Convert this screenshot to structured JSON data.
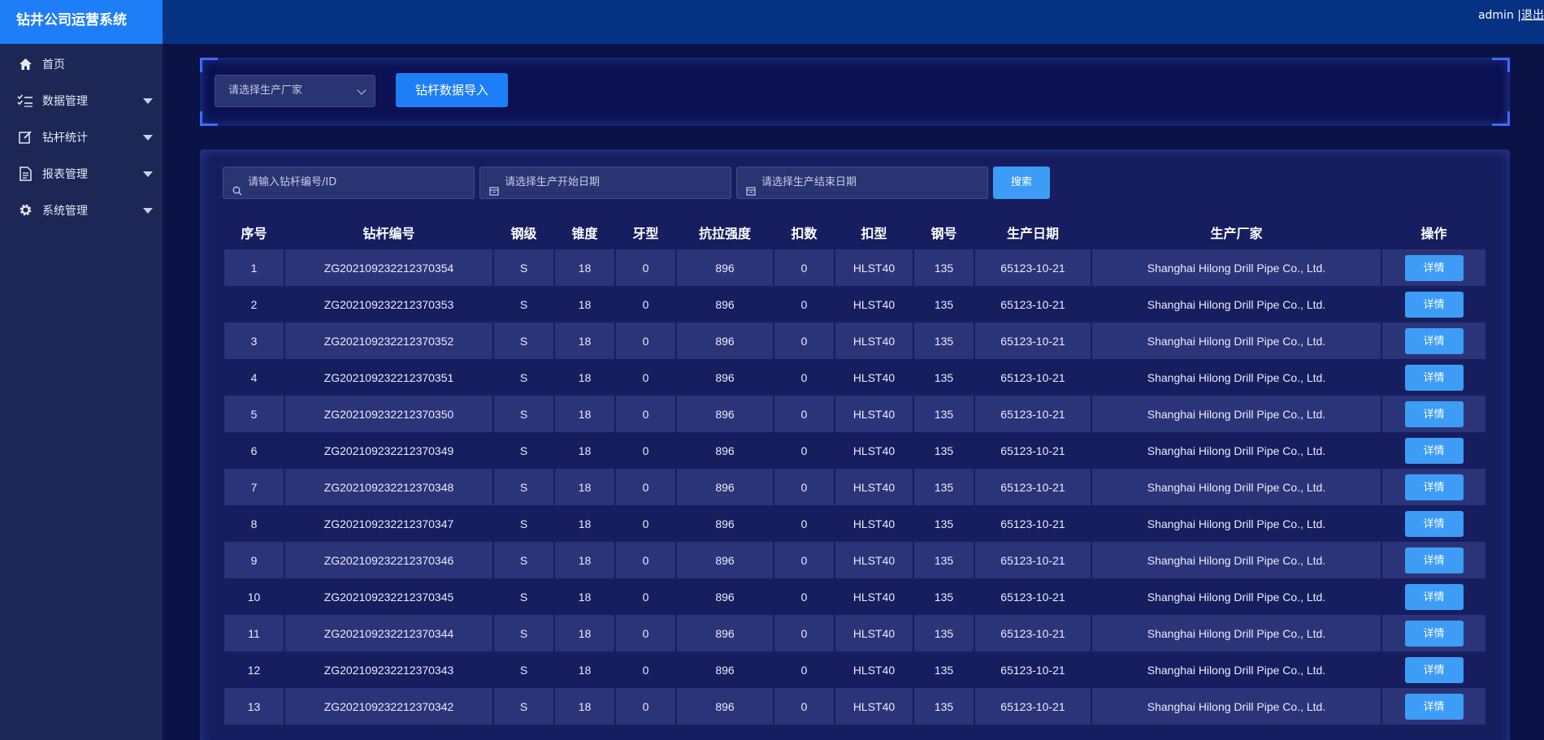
{
  "app": {
    "title": "钻井公司运营系统"
  },
  "header": {
    "user": "admin",
    "separator": "|",
    "logout": "退出"
  },
  "sidebar": {
    "items": [
      {
        "label": "首页",
        "icon": "home-icon",
        "has_submenu": false
      },
      {
        "label": "数据管理",
        "icon": "checklist-icon",
        "has_submenu": true
      },
      {
        "label": "钻杆统计",
        "icon": "edit-icon",
        "has_submenu": true
      },
      {
        "label": "报表管理",
        "icon": "document-icon",
        "has_submenu": true
      },
      {
        "label": "系统管理",
        "icon": "gear-icon",
        "has_submenu": true
      }
    ]
  },
  "filter": {
    "manufacturer_placeholder": "请选择生产厂家",
    "import_label": "钻杆数据导入"
  },
  "search": {
    "id_placeholder": "请输入钻杆编号/ID",
    "start_date_placeholder": "请选择生产开始日期",
    "end_date_placeholder": "请选择生产结束日期",
    "button_label": "搜索"
  },
  "table": {
    "headers": [
      "序号",
      "钻杆编号",
      "钢级",
      "锥度",
      "牙型",
      "抗拉强度",
      "扣数",
      "扣型",
      "钢号",
      "生产日期",
      "生产厂家",
      "操作"
    ],
    "action_label": "详情",
    "rows": [
      [
        "1",
        "ZG202109232212370354",
        "S",
        "18",
        "0",
        "896",
        "0",
        "HLST40",
        "135",
        "65123-10-21",
        "Shanghai Hilong Drill Pipe Co., Ltd."
      ],
      [
        "2",
        "ZG202109232212370353",
        "S",
        "18",
        "0",
        "896",
        "0",
        "HLST40",
        "135",
        "65123-10-21",
        "Shanghai Hilong Drill Pipe Co., Ltd."
      ],
      [
        "3",
        "ZG202109232212370352",
        "S",
        "18",
        "0",
        "896",
        "0",
        "HLST40",
        "135",
        "65123-10-21",
        "Shanghai Hilong Drill Pipe Co., Ltd."
      ],
      [
        "4",
        "ZG202109232212370351",
        "S",
        "18",
        "0",
        "896",
        "0",
        "HLST40",
        "135",
        "65123-10-21",
        "Shanghai Hilong Drill Pipe Co., Ltd."
      ],
      [
        "5",
        "ZG202109232212370350",
        "S",
        "18",
        "0",
        "896",
        "0",
        "HLST40",
        "135",
        "65123-10-21",
        "Shanghai Hilong Drill Pipe Co., Ltd."
      ],
      [
        "6",
        "ZG202109232212370349",
        "S",
        "18",
        "0",
        "896",
        "0",
        "HLST40",
        "135",
        "65123-10-21",
        "Shanghai Hilong Drill Pipe Co., Ltd."
      ],
      [
        "7",
        "ZG202109232212370348",
        "S",
        "18",
        "0",
        "896",
        "0",
        "HLST40",
        "135",
        "65123-10-21",
        "Shanghai Hilong Drill Pipe Co., Ltd."
      ],
      [
        "8",
        "ZG202109232212370347",
        "S",
        "18",
        "0",
        "896",
        "0",
        "HLST40",
        "135",
        "65123-10-21",
        "Shanghai Hilong Drill Pipe Co., Ltd."
      ],
      [
        "9",
        "ZG202109232212370346",
        "S",
        "18",
        "0",
        "896",
        "0",
        "HLST40",
        "135",
        "65123-10-21",
        "Shanghai Hilong Drill Pipe Co., Ltd."
      ],
      [
        "10",
        "ZG202109232212370345",
        "S",
        "18",
        "0",
        "896",
        "0",
        "HLST40",
        "135",
        "65123-10-21",
        "Shanghai Hilong Drill Pipe Co., Ltd."
      ],
      [
        "11",
        "ZG202109232212370344",
        "S",
        "18",
        "0",
        "896",
        "0",
        "HLST40",
        "135",
        "65123-10-21",
        "Shanghai Hilong Drill Pipe Co., Ltd."
      ],
      [
        "12",
        "ZG202109232212370343",
        "S",
        "18",
        "0",
        "896",
        "0",
        "HLST40",
        "135",
        "65123-10-21",
        "Shanghai Hilong Drill Pipe Co., Ltd."
      ],
      [
        "13",
        "ZG202109232212370342",
        "S",
        "18",
        "0",
        "896",
        "0",
        "HLST40",
        "135",
        "65123-10-21",
        "Shanghai Hilong Drill Pipe Co., Ltd."
      ]
    ]
  },
  "colors": {
    "accent": "#1e7ef7",
    "button": "#3d9cf5",
    "header_bg": "#063283",
    "sidebar_bg": "#1c2755",
    "page_bg": "#0a1246",
    "row_stripe": "#2c3479"
  }
}
